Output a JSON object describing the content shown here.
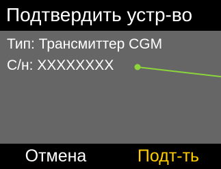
{
  "header": {
    "title": "Подтвердить устр-во"
  },
  "details": {
    "type_line": "Тип: Трансмиттер CGM",
    "serial_line": "С/н: XXXXXXXX"
  },
  "softkeys": {
    "left_label": "Отмена",
    "right_label": "Подт-ть"
  },
  "colors": {
    "background": "#000000",
    "content_panel": "#666666",
    "text": "#ffffff",
    "highlight": "#ffcc00",
    "pointer": "#8cd63c"
  }
}
